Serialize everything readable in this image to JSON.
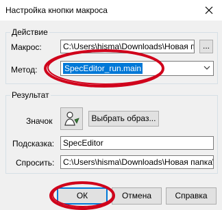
{
  "window": {
    "title": "Настройка кнопки макроса"
  },
  "action_group": {
    "title": "Действие",
    "macro_label": "Макрос:",
    "macro_value": "C:\\Users\\hisma\\Downloads\\Новая п",
    "browse_label": "...",
    "method_label": "Метод:",
    "method_value": "SpecEditor_run.main"
  },
  "result_group": {
    "title": "Результат",
    "icon_label": "Значок",
    "choose_image_label": "Выбрать образ...",
    "tooltip_label": "Подсказка:",
    "tooltip_value": "SpecEditor",
    "ask_label": "Спросить:",
    "ask_value": "C:\\Users\\hisma\\Downloads\\Новая папка\\"
  },
  "footer": {
    "ok_label": "ОК",
    "cancel_label": "Отмена",
    "help_label": "Справка"
  },
  "colors": {
    "background": "#f0f0f0",
    "selection": "#0078d7",
    "annotation": "#d0021b"
  }
}
